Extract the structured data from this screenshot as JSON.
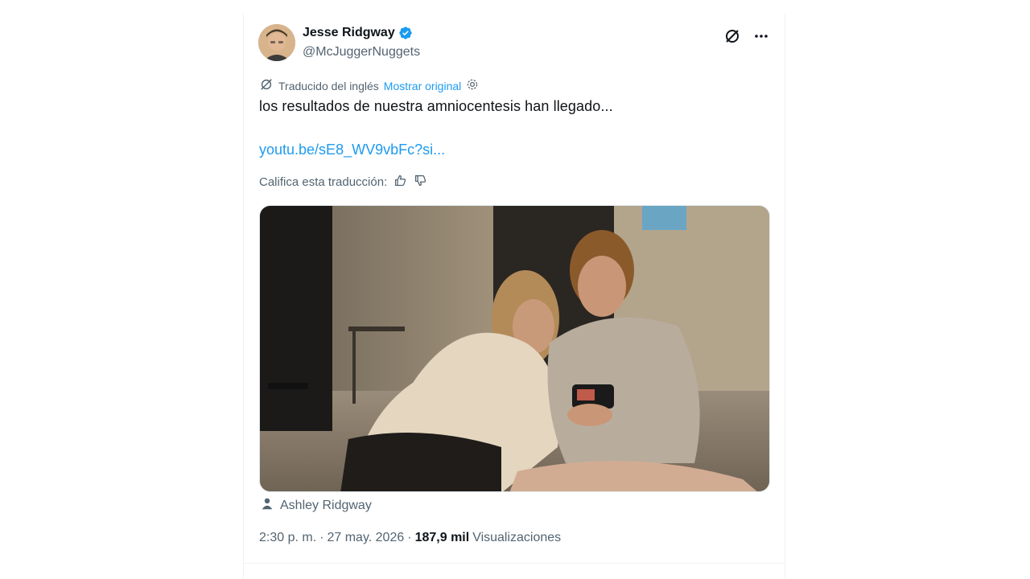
{
  "author": {
    "name": "Jesse Ridgway",
    "handle": "@McJuggerNuggets",
    "verified": true
  },
  "translation": {
    "label": "Traducido del inglés",
    "show_original": "Mostrar original",
    "rate_label": "Califica esta traducción:"
  },
  "tweet": {
    "text": "los resultados de nuestra amniocentesis han llegado...",
    "link": "youtu.be/sE8_WV9vbFc?si..."
  },
  "media": {
    "tagged_user": "Ashley Ridgway"
  },
  "meta": {
    "time": "2:30 p. m.",
    "separator": "·",
    "date": "27 may. 2026",
    "views_count": "187,9 mil",
    "views_label": "Visualizaciones"
  },
  "colors": {
    "accent": "#1d9bf0",
    "secondary_text": "#536471",
    "primary_text": "#0f1419"
  },
  "icons": {
    "verified": "verified-badge-icon",
    "grok": "grok-icon",
    "more": "more-icon",
    "translate": "translate-icon",
    "settings": "settings-icon",
    "thumbs_up": "thumbs-up-icon",
    "thumbs_down": "thumbs-down-icon",
    "person": "person-icon"
  }
}
